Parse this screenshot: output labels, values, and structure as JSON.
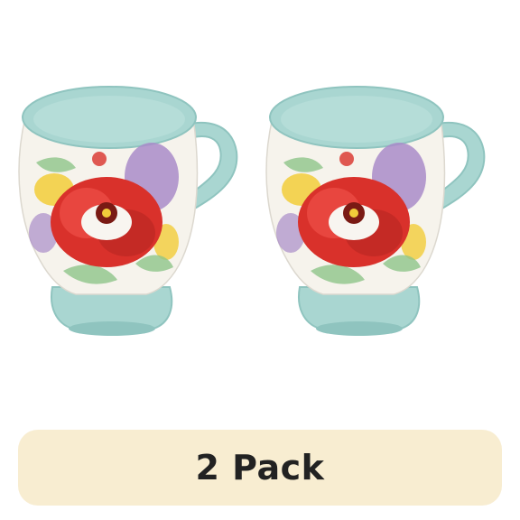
{
  "product": {
    "image_subject": "mug",
    "mug_count": 2
  },
  "pack_badge": {
    "label": "2 Pack"
  },
  "colors": {
    "banner_background": "#f8edd1",
    "banner_text": "#222222",
    "mug_glaze": "#a9d6d1",
    "mug_glaze_dark": "#8fc4bf",
    "mug_interior": "#b5ddd8",
    "mug_body": "#f6f3ec",
    "flower_red": "#d9312b",
    "flower_purple": "#a98bc9",
    "flower_yellow": "#f2cc3a",
    "leaf_green": "#8fc48a"
  }
}
